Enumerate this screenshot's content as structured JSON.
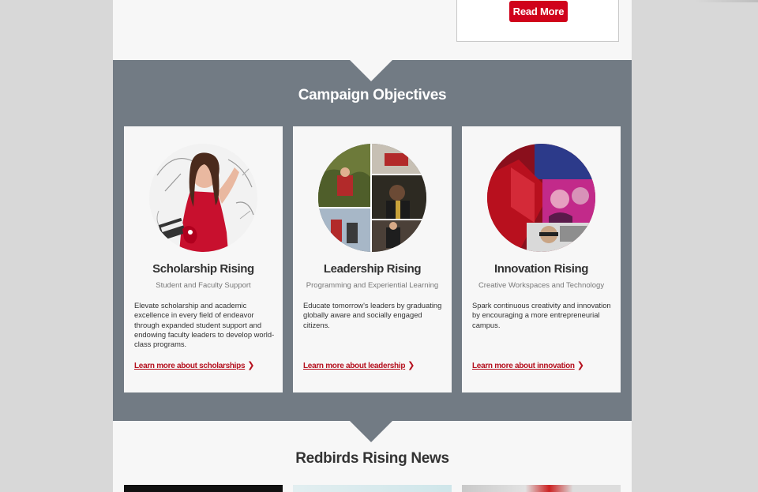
{
  "promo": {
    "read_more_label": "Read More"
  },
  "objectives": {
    "title": "Campaign Objectives",
    "cards": [
      {
        "title": "Scholarship Rising",
        "subtitle": "Student and Faculty Support",
        "description": "Elevate scholarship and academic excellence in every field of endeavor through expanded student support and endowing faculty leaders to develop world-class programs.",
        "link": "Learn more about scholarships"
      },
      {
        "title": "Leadership Rising",
        "subtitle": "Programming and Experiential Learning",
        "description": "Educate tomorrow's leaders by graduating globally aware and socially engaged citizens.",
        "link": "Learn more about leadership"
      },
      {
        "title": "Innovation Rising",
        "subtitle": "Creative Workspaces and Technology",
        "description": "Spark continuous creativity and innovation by encouraging a more entrepreneurial campus.",
        "link": "Learn more about innovation"
      }
    ]
  },
  "news": {
    "title": "Redbirds Rising News"
  },
  "colors": {
    "accent_red": "#d0021b",
    "band_gray": "#727b84",
    "link_red": "#b5101e"
  }
}
